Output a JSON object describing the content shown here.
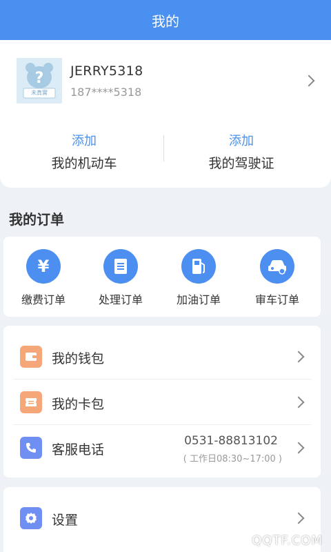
{
  "header": {
    "title": "我的"
  },
  "profile": {
    "avatar_badge": "未真實",
    "username": "JERRY5318",
    "phone": "187****5318"
  },
  "quick_actions": [
    {
      "action": "添加",
      "label": "我的机动车"
    },
    {
      "action": "添加",
      "label": "我的驾驶证"
    }
  ],
  "orders": {
    "title": "我的订单",
    "items": [
      {
        "label": "缴费订单",
        "icon": "yuan-icon"
      },
      {
        "label": "处理订单",
        "icon": "document-icon"
      },
      {
        "label": "加油订单",
        "icon": "fuel-pump-icon"
      },
      {
        "label": "审车订单",
        "icon": "car-inspection-icon"
      }
    ]
  },
  "menu": {
    "wallet": {
      "label": "我的钱包",
      "icon": "wallet-icon"
    },
    "cards": {
      "label": "我的卡包",
      "icon": "ticket-icon"
    },
    "service": {
      "label": "客服电话",
      "icon": "phone-icon",
      "number": "0531-88813102",
      "hours": "( 工作日08:30~17:00 )"
    }
  },
  "settings": {
    "label": "设置",
    "icon": "gear-icon"
  },
  "watermark": "QQTF.COM",
  "colors": {
    "primary": "#4a90f0",
    "background": "#eef1f6",
    "wallet": "#f5a77a",
    "phone_icon": "#6f8ff2",
    "settings_icon": "#6f8ff2"
  }
}
